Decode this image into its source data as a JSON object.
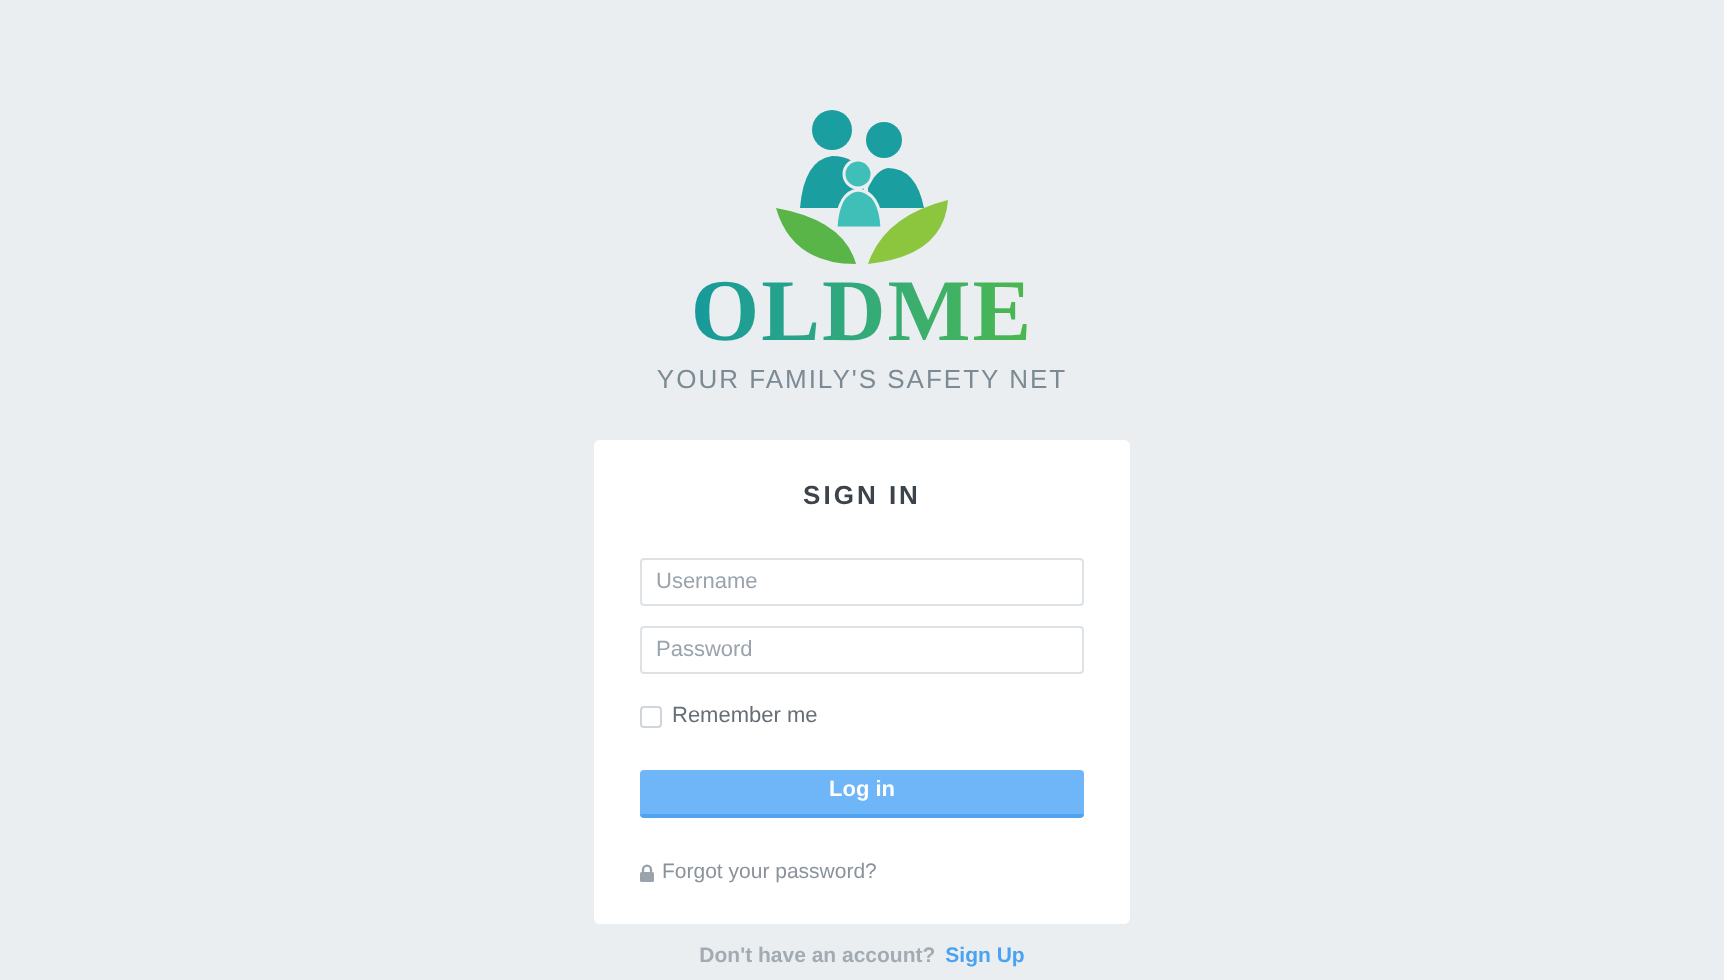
{
  "logo": {
    "name": "OLDME",
    "tagline": "YOUR FAMILY'S SAFETY NET"
  },
  "form": {
    "title": "SIGN IN",
    "fields": [
      {
        "placeholder": "Username"
      },
      {
        "placeholder": "Password"
      }
    ],
    "remember": {
      "label": "Remember me",
      "checked": false
    },
    "submit": "Log in",
    "forgot": "Forgot your password?"
  },
  "footer": {
    "prompt": "Don't have an account?",
    "link": "Sign Up"
  }
}
